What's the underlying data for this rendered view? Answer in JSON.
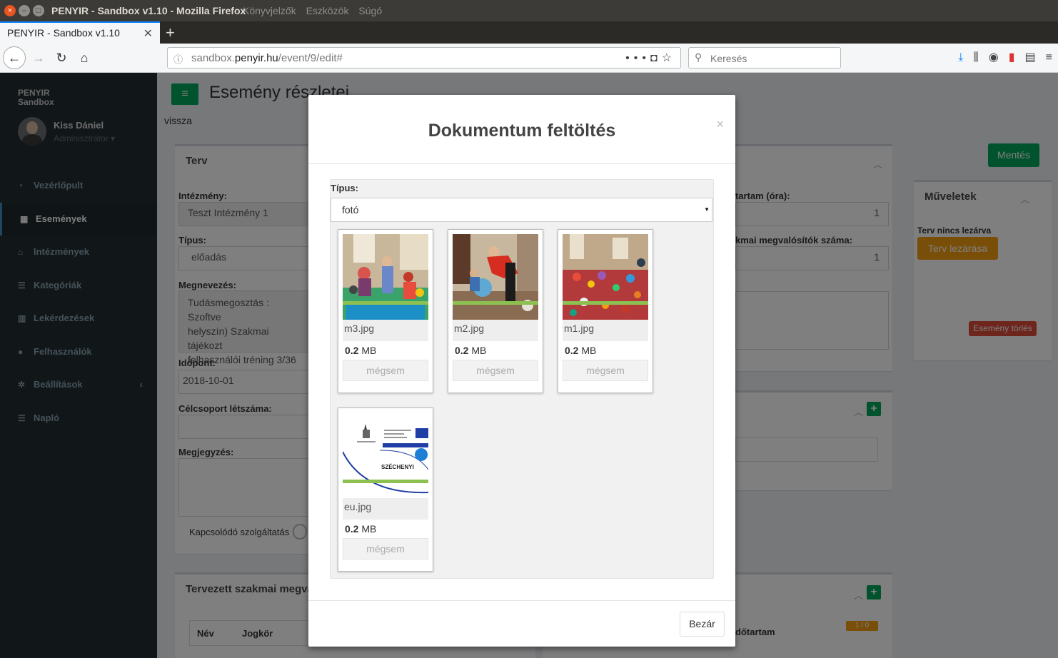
{
  "window": {
    "title": "PENYIR - Sandbox v1.10 - Mozilla Firefox",
    "ghost_menu": [
      "Könyvjelzők",
      "Eszközök",
      "Súgó"
    ]
  },
  "browser": {
    "tab_title": "PENYIR - Sandbox v1.10",
    "url_prefix": "sandbox.",
    "url_domain": "penyir.hu",
    "url_path": "/event/9/edit#",
    "search_placeholder": "Keresés"
  },
  "sidebar": {
    "brand_line1": "PENYIR",
    "brand_line2": "Sandbox",
    "user_name": "Kiss Dániel",
    "user_role": "Adminisztrátor",
    "items": [
      {
        "label": "Vezérlőpult",
        "icon": "dashboard-icon"
      },
      {
        "label": "Események",
        "icon": "calendar-icon"
      },
      {
        "label": "Intézmények",
        "icon": "institution-icon"
      },
      {
        "label": "Kategóriák",
        "icon": "list-icon"
      },
      {
        "label": "Lekérdezések",
        "icon": "bar-chart-icon"
      },
      {
        "label": "Felhasználók",
        "icon": "user-icon"
      },
      {
        "label": "Beállítások",
        "icon": "gear-icon"
      },
      {
        "label": "Napló",
        "icon": "list-icon"
      }
    ]
  },
  "page": {
    "title": "Esemény részletei",
    "back_link": "vissza",
    "save_label": "Mentés",
    "plan_box_title": "Terv",
    "institution_label": "Intézmény:",
    "institution_value": "Teszt Intézmény 1",
    "type_label": "Típus:",
    "type_value": "előadás",
    "name_label": "Megnevezés:",
    "name_line1": "Tudásmegosztás : Szoftve",
    "name_line2": "helyszín) Szakmai tájékozt",
    "name_line3": "felhasználói tréning 3/36",
    "date_label": "Időpont:",
    "date_value": "2018-10-01",
    "target_label": "Célcsoport létszáma:",
    "note_label": "Megjegyzés:",
    "related_label": "Kapcsolódó szolgáltatás",
    "duration_label": "tartam (óra):",
    "duration_value": "1",
    "experts_label": "kmai megvalósítók száma:",
    "experts_value": "1",
    "operations_title": "Műveletek",
    "plan_status": "Terv nincs lezárva",
    "close_plan_label": "Terv lezárása",
    "delete_event_label": "Esemény törlés",
    "planned_experts_title": "Tervezett szakmai megva",
    "col_name": "Név",
    "col_role": "Jogkör",
    "col_duration": "dőtartam",
    "pager_badge": "1 / 0"
  },
  "modal": {
    "title": "Dokumentum feltöltés",
    "type_label": "Típus:",
    "type_value": "fotó",
    "close_label": "Bezár",
    "files": [
      {
        "name": "m3.jpg",
        "size_value": "0.2",
        "size_unit": "MB",
        "cancel": "mégsem",
        "progress": 1.0
      },
      {
        "name": "m2.jpg",
        "size_value": "0.2",
        "size_unit": "MB",
        "cancel": "mégsem",
        "progress": 1.0
      },
      {
        "name": "m1.jpg",
        "size_value": "0.2",
        "size_unit": "MB",
        "cancel": "mégsem",
        "progress": 1.0
      },
      {
        "name": "eu.jpg",
        "size_value": "0.2",
        "size_unit": "MB",
        "cancel": "mégsem",
        "progress": 1.0,
        "logo_text": "SZÉCHENYI"
      }
    ]
  }
}
